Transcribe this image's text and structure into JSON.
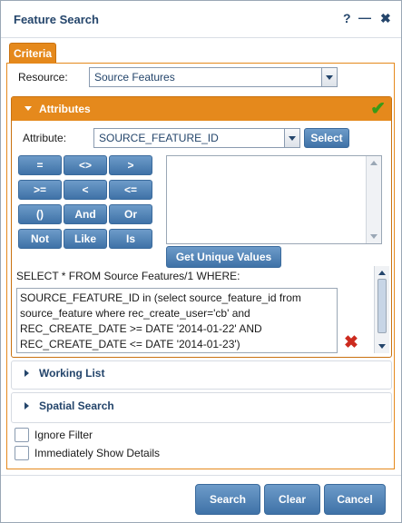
{
  "window": {
    "title": "Feature Search",
    "help_glyph": "?",
    "minimize_glyph": "—",
    "close_glyph": "✖"
  },
  "tabs": [
    {
      "label": "Criteria"
    }
  ],
  "resource": {
    "label": "Resource:",
    "value": "Source Features"
  },
  "attributes": {
    "title": "Attributes",
    "status_glyph": "✔",
    "attribute_label": "Attribute:",
    "attribute_value": "SOURCE_FEATURE_ID",
    "select_button": "Select",
    "operators": [
      "=",
      "<>",
      ">",
      ">=",
      "<",
      "<=",
      "()",
      "And",
      "Or",
      "Not",
      "Like",
      "Is"
    ],
    "unique_values_button": "Get Unique Values",
    "query_prefix": "SELECT * FROM Source Features/1 WHERE:",
    "query_lines": [
      "SOURCE_FEATURE_ID in (select source_feature_id from",
      "source_feature where rec_create_user='cb' and",
      "REC_CREATE_DATE >= DATE '2014-01-22' AND",
      "REC_CREATE_DATE <= DATE '2014-01-23')"
    ],
    "clear_glyph": "✖"
  },
  "sections": [
    {
      "title": "Working List"
    },
    {
      "title": "Spatial Search"
    }
  ],
  "options": [
    {
      "label": "Ignore Filter",
      "checked": false
    },
    {
      "label": "Immediately Show Details",
      "checked": false
    }
  ],
  "footer": {
    "search": "Search",
    "clear": "Clear",
    "cancel": "Cancel"
  },
  "colors": {
    "accent": "#e5891c",
    "title": "#24456b",
    "button": "#4f80b4",
    "check": "#3a9a17",
    "delete": "#cc2a1e"
  }
}
